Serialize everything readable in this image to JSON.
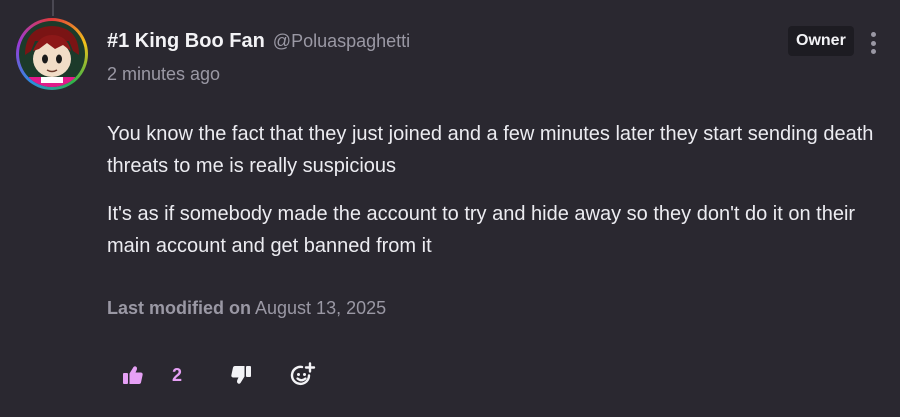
{
  "post": {
    "author": {
      "display_name": "#1 King Boo Fan",
      "username": "@Poluaspaghetti",
      "badge": "Owner",
      "avatar_icon": "avatar-character-icon"
    },
    "timestamp": "2 minutes ago",
    "paragraphs": [
      "You know the fact that they just joined and a few minutes later they start sending death threats to me is really suspicious",
      "It's as if somebody made the account to try and hide away so they don't do it on their main account and get banned from it"
    ],
    "modified": {
      "label": "Last modified on",
      "date": "August 13, 2025"
    },
    "actions": {
      "like_icon": "thumbs-up-icon",
      "like_count": "2",
      "dislike_icon": "thumbs-down-icon",
      "react_icon": "add-reaction-icon",
      "menu_icon": "more-vertical-icon"
    }
  },
  "colors": {
    "background": "#2a2830",
    "accent": "#e6a0f5",
    "muted_text": "#9a98a4",
    "badge_bg": "#1d1c22"
  }
}
